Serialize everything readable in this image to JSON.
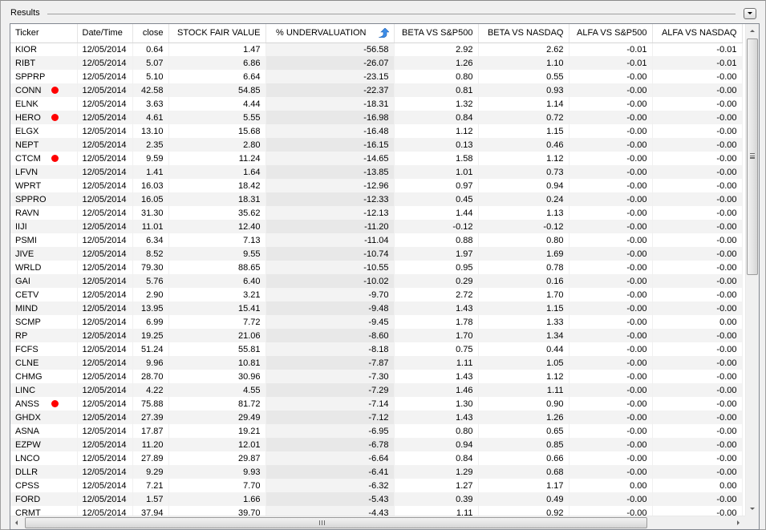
{
  "panel": {
    "title": "Results",
    "collapse_button": "chevron-down-icon"
  },
  "grid": {
    "sorted_column_index": 4,
    "sort_direction": "ascending",
    "flag_color": "#ff0000",
    "columns": [
      "Ticker",
      "Date/Time",
      "close",
      "STOCK FAIR VALUE",
      "% UNDERVALUATION",
      "BETA VS S&P500",
      "BETA VS NASDAQ",
      "ALFA VS S&P500",
      "ALFA VS NASDAQ"
    ],
    "rows": [
      {
        "ticker": "KIOR",
        "flag": false,
        "date": "12/05/2014",
        "close": "0.64",
        "fair": "1.47",
        "underval": "-56.58",
        "beta_sp": "2.92",
        "beta_nq": "2.62",
        "alfa_sp": "-0.01",
        "alfa_nq": "-0.01"
      },
      {
        "ticker": "RIBT",
        "flag": false,
        "date": "12/05/2014",
        "close": "5.07",
        "fair": "6.86",
        "underval": "-26.07",
        "beta_sp": "1.26",
        "beta_nq": "1.10",
        "alfa_sp": "-0.01",
        "alfa_nq": "-0.01"
      },
      {
        "ticker": "SPPRP",
        "flag": false,
        "date": "12/05/2014",
        "close": "5.10",
        "fair": "6.64",
        "underval": "-23.15",
        "beta_sp": "0.80",
        "beta_nq": "0.55",
        "alfa_sp": "-0.00",
        "alfa_nq": "-0.00"
      },
      {
        "ticker": "CONN",
        "flag": true,
        "date": "12/05/2014",
        "close": "42.58",
        "fair": "54.85",
        "underval": "-22.37",
        "beta_sp": "0.81",
        "beta_nq": "0.93",
        "alfa_sp": "-0.00",
        "alfa_nq": "-0.00"
      },
      {
        "ticker": "ELNK",
        "flag": false,
        "date": "12/05/2014",
        "close": "3.63",
        "fair": "4.44",
        "underval": "-18.31",
        "beta_sp": "1.32",
        "beta_nq": "1.14",
        "alfa_sp": "-0.00",
        "alfa_nq": "-0.00"
      },
      {
        "ticker": "HERO",
        "flag": true,
        "date": "12/05/2014",
        "close": "4.61",
        "fair": "5.55",
        "underval": "-16.98",
        "beta_sp": "0.84",
        "beta_nq": "0.72",
        "alfa_sp": "-0.00",
        "alfa_nq": "-0.00"
      },
      {
        "ticker": "ELGX",
        "flag": false,
        "date": "12/05/2014",
        "close": "13.10",
        "fair": "15.68",
        "underval": "-16.48",
        "beta_sp": "1.12",
        "beta_nq": "1.15",
        "alfa_sp": "-0.00",
        "alfa_nq": "-0.00"
      },
      {
        "ticker": "NEPT",
        "flag": false,
        "date": "12/05/2014",
        "close": "2.35",
        "fair": "2.80",
        "underval": "-16.15",
        "beta_sp": "0.13",
        "beta_nq": "0.46",
        "alfa_sp": "-0.00",
        "alfa_nq": "-0.00"
      },
      {
        "ticker": "CTCM",
        "flag": true,
        "date": "12/05/2014",
        "close": "9.59",
        "fair": "11.24",
        "underval": "-14.65",
        "beta_sp": "1.58",
        "beta_nq": "1.12",
        "alfa_sp": "-0.00",
        "alfa_nq": "-0.00"
      },
      {
        "ticker": "LFVN",
        "flag": false,
        "date": "12/05/2014",
        "close": "1.41",
        "fair": "1.64",
        "underval": "-13.85",
        "beta_sp": "1.01",
        "beta_nq": "0.73",
        "alfa_sp": "-0.00",
        "alfa_nq": "-0.00"
      },
      {
        "ticker": "WPRT",
        "flag": false,
        "date": "12/05/2014",
        "close": "16.03",
        "fair": "18.42",
        "underval": "-12.96",
        "beta_sp": "0.97",
        "beta_nq": "0.94",
        "alfa_sp": "-0.00",
        "alfa_nq": "-0.00"
      },
      {
        "ticker": "SPPRO",
        "flag": false,
        "date": "12/05/2014",
        "close": "16.05",
        "fair": "18.31",
        "underval": "-12.33",
        "beta_sp": "0.45",
        "beta_nq": "0.24",
        "alfa_sp": "-0.00",
        "alfa_nq": "-0.00"
      },
      {
        "ticker": "RAVN",
        "flag": false,
        "date": "12/05/2014",
        "close": "31.30",
        "fair": "35.62",
        "underval": "-12.13",
        "beta_sp": "1.44",
        "beta_nq": "1.13",
        "alfa_sp": "-0.00",
        "alfa_nq": "-0.00"
      },
      {
        "ticker": "IIJI",
        "flag": false,
        "date": "12/05/2014",
        "close": "11.01",
        "fair": "12.40",
        "underval": "-11.20",
        "beta_sp": "-0.12",
        "beta_nq": "-0.12",
        "alfa_sp": "-0.00",
        "alfa_nq": "-0.00"
      },
      {
        "ticker": "PSMI",
        "flag": false,
        "date": "12/05/2014",
        "close": "6.34",
        "fair": "7.13",
        "underval": "-11.04",
        "beta_sp": "0.88",
        "beta_nq": "0.80",
        "alfa_sp": "-0.00",
        "alfa_nq": "-0.00"
      },
      {
        "ticker": "JIVE",
        "flag": false,
        "date": "12/05/2014",
        "close": "8.52",
        "fair": "9.55",
        "underval": "-10.74",
        "beta_sp": "1.97",
        "beta_nq": "1.69",
        "alfa_sp": "-0.00",
        "alfa_nq": "-0.00"
      },
      {
        "ticker": "WRLD",
        "flag": false,
        "date": "12/05/2014",
        "close": "79.30",
        "fair": "88.65",
        "underval": "-10.55",
        "beta_sp": "0.95",
        "beta_nq": "0.78",
        "alfa_sp": "-0.00",
        "alfa_nq": "-0.00"
      },
      {
        "ticker": "GAI",
        "flag": false,
        "date": "12/05/2014",
        "close": "5.76",
        "fair": "6.40",
        "underval": "-10.02",
        "beta_sp": "0.29",
        "beta_nq": "0.16",
        "alfa_sp": "-0.00",
        "alfa_nq": "-0.00"
      },
      {
        "ticker": "CETV",
        "flag": false,
        "date": "12/05/2014",
        "close": "2.90",
        "fair": "3.21",
        "underval": "-9.70",
        "beta_sp": "2.72",
        "beta_nq": "1.70",
        "alfa_sp": "-0.00",
        "alfa_nq": "-0.00"
      },
      {
        "ticker": "MIND",
        "flag": false,
        "date": "12/05/2014",
        "close": "13.95",
        "fair": "15.41",
        "underval": "-9.48",
        "beta_sp": "1.43",
        "beta_nq": "1.15",
        "alfa_sp": "-0.00",
        "alfa_nq": "-0.00"
      },
      {
        "ticker": "SCMP",
        "flag": false,
        "date": "12/05/2014",
        "close": "6.99",
        "fair": "7.72",
        "underval": "-9.45",
        "beta_sp": "1.78",
        "beta_nq": "1.33",
        "alfa_sp": "-0.00",
        "alfa_nq": "0.00"
      },
      {
        "ticker": "RP",
        "flag": false,
        "date": "12/05/2014",
        "close": "19.25",
        "fair": "21.06",
        "underval": "-8.60",
        "beta_sp": "1.70",
        "beta_nq": "1.34",
        "alfa_sp": "-0.00",
        "alfa_nq": "-0.00"
      },
      {
        "ticker": "FCFS",
        "flag": false,
        "date": "12/05/2014",
        "close": "51.24",
        "fair": "55.81",
        "underval": "-8.18",
        "beta_sp": "0.75",
        "beta_nq": "0.44",
        "alfa_sp": "-0.00",
        "alfa_nq": "-0.00"
      },
      {
        "ticker": "CLNE",
        "flag": false,
        "date": "12/05/2014",
        "close": "9.96",
        "fair": "10.81",
        "underval": "-7.87",
        "beta_sp": "1.11",
        "beta_nq": "1.05",
        "alfa_sp": "-0.00",
        "alfa_nq": "-0.00"
      },
      {
        "ticker": "CHMG",
        "flag": false,
        "date": "12/05/2014",
        "close": "28.70",
        "fair": "30.96",
        "underval": "-7.30",
        "beta_sp": "1.43",
        "beta_nq": "1.12",
        "alfa_sp": "-0.00",
        "alfa_nq": "-0.00"
      },
      {
        "ticker": "LINC",
        "flag": false,
        "date": "12/05/2014",
        "close": "4.22",
        "fair": "4.55",
        "underval": "-7.29",
        "beta_sp": "1.46",
        "beta_nq": "1.11",
        "alfa_sp": "-0.00",
        "alfa_nq": "-0.00"
      },
      {
        "ticker": "ANSS",
        "flag": true,
        "date": "12/05/2014",
        "close": "75.88",
        "fair": "81.72",
        "underval": "-7.14",
        "beta_sp": "1.30",
        "beta_nq": "0.90",
        "alfa_sp": "-0.00",
        "alfa_nq": "-0.00"
      },
      {
        "ticker": "GHDX",
        "flag": false,
        "date": "12/05/2014",
        "close": "27.39",
        "fair": "29.49",
        "underval": "-7.12",
        "beta_sp": "1.43",
        "beta_nq": "1.26",
        "alfa_sp": "-0.00",
        "alfa_nq": "-0.00"
      },
      {
        "ticker": "ASNA",
        "flag": false,
        "date": "12/05/2014",
        "close": "17.87",
        "fair": "19.21",
        "underval": "-6.95",
        "beta_sp": "0.80",
        "beta_nq": "0.65",
        "alfa_sp": "-0.00",
        "alfa_nq": "-0.00"
      },
      {
        "ticker": "EZPW",
        "flag": false,
        "date": "12/05/2014",
        "close": "11.20",
        "fair": "12.01",
        "underval": "-6.78",
        "beta_sp": "0.94",
        "beta_nq": "0.85",
        "alfa_sp": "-0.00",
        "alfa_nq": "-0.00"
      },
      {
        "ticker": "LNCO",
        "flag": false,
        "date": "12/05/2014",
        "close": "27.89",
        "fair": "29.87",
        "underval": "-6.64",
        "beta_sp": "0.84",
        "beta_nq": "0.66",
        "alfa_sp": "-0.00",
        "alfa_nq": "-0.00"
      },
      {
        "ticker": "DLLR",
        "flag": false,
        "date": "12/05/2014",
        "close": "9.29",
        "fair": "9.93",
        "underval": "-6.41",
        "beta_sp": "1.29",
        "beta_nq": "0.68",
        "alfa_sp": "-0.00",
        "alfa_nq": "-0.00"
      },
      {
        "ticker": "CPSS",
        "flag": false,
        "date": "12/05/2014",
        "close": "7.21",
        "fair": "7.70",
        "underval": "-6.32",
        "beta_sp": "1.27",
        "beta_nq": "1.17",
        "alfa_sp": "0.00",
        "alfa_nq": "0.00"
      },
      {
        "ticker": "FORD",
        "flag": false,
        "date": "12/05/2014",
        "close": "1.57",
        "fair": "1.66",
        "underval": "-5.43",
        "beta_sp": "0.39",
        "beta_nq": "0.49",
        "alfa_sp": "-0.00",
        "alfa_nq": "-0.00"
      },
      {
        "ticker": "CRMT",
        "flag": false,
        "date": "12/05/2014",
        "close": "37.94",
        "fair": "39.70",
        "underval": "-4.43",
        "beta_sp": "1.11",
        "beta_nq": "0.92",
        "alfa_sp": "-0.00",
        "alfa_nq": "-0.00"
      }
    ]
  },
  "scrollbars": {
    "vertical": {
      "position_fraction": 0.0,
      "visible_fraction": 0.5
    },
    "horizontal": {
      "position_fraction": 0.0,
      "visible_fraction": 0.88
    }
  }
}
